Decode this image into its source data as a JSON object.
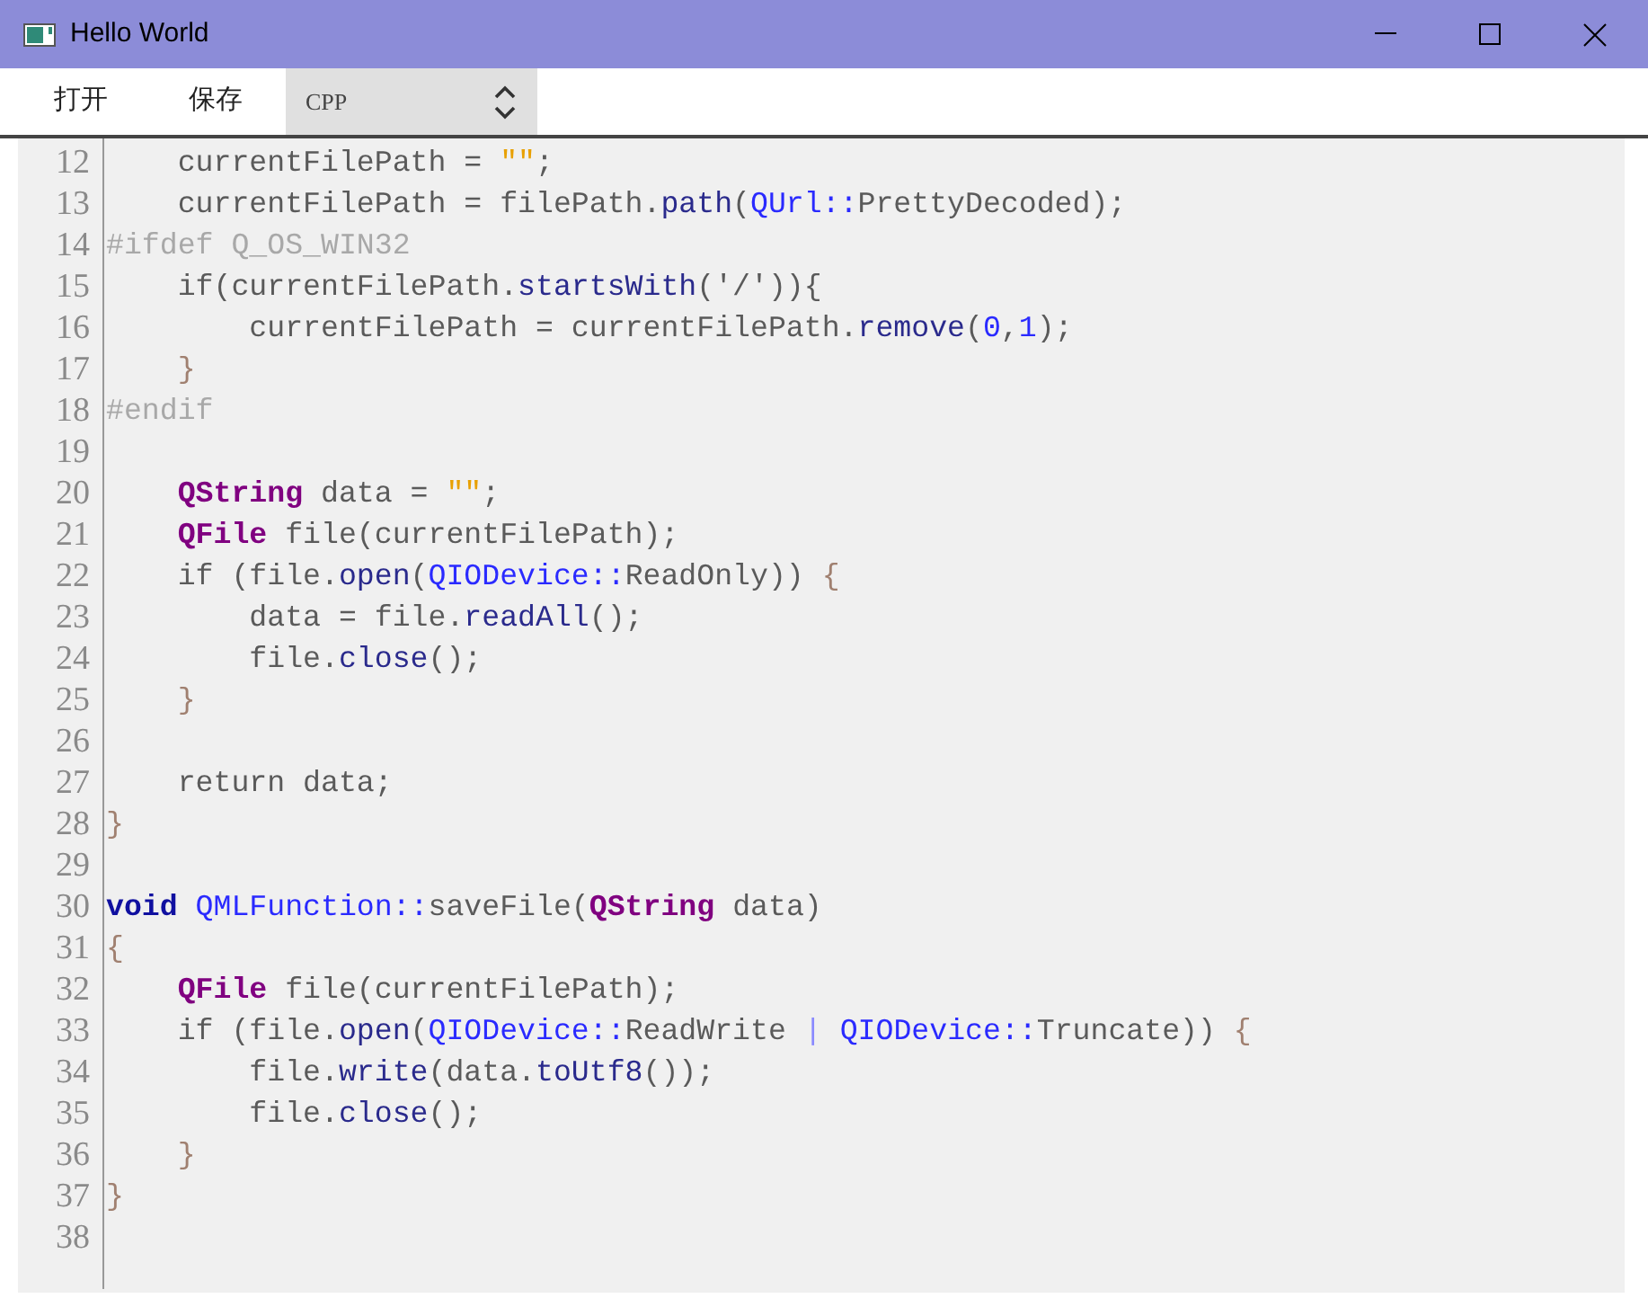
{
  "window": {
    "title": "Hello World"
  },
  "toolbar": {
    "buttons": [
      {
        "label": "打开"
      },
      {
        "label": "保存"
      }
    ],
    "language_select": {
      "value": "CPP"
    }
  },
  "editor": {
    "lines": [
      {
        "number": "12",
        "tokens": [
          {
            "kind": "plain",
            "text": "    currentFilePath = "
          },
          {
            "kind": "string",
            "text": "\"\""
          },
          {
            "kind": "plain",
            "text": ";"
          }
        ]
      },
      {
        "number": "13",
        "tokens": [
          {
            "kind": "plain",
            "text": "    currentFilePath = filePath."
          },
          {
            "kind": "method",
            "text": "path"
          },
          {
            "kind": "plain",
            "text": "("
          },
          {
            "kind": "scope",
            "text": "QUrl::"
          },
          {
            "kind": "plain",
            "text": "PrettyDecoded);"
          }
        ]
      },
      {
        "number": "14",
        "tokens": [
          {
            "kind": "preproc",
            "text": "#ifdef Q_OS_WIN32"
          }
        ]
      },
      {
        "number": "15",
        "tokens": [
          {
            "kind": "plain",
            "text": "    if(currentFilePath."
          },
          {
            "kind": "method",
            "text": "startsWith"
          },
          {
            "kind": "plain",
            "text": "('/')){"
          }
        ]
      },
      {
        "number": "16",
        "tokens": [
          {
            "kind": "plain",
            "text": "        currentFilePath = currentFilePath."
          },
          {
            "kind": "method",
            "text": "remove"
          },
          {
            "kind": "plain",
            "text": "("
          },
          {
            "kind": "number",
            "text": "0"
          },
          {
            "kind": "plain",
            "text": ","
          },
          {
            "kind": "number",
            "text": "1"
          },
          {
            "kind": "plain",
            "text": ");"
          }
        ]
      },
      {
        "number": "17",
        "tokens": [
          {
            "kind": "brace",
            "text": "    }"
          }
        ]
      },
      {
        "number": "18",
        "tokens": [
          {
            "kind": "preproc",
            "text": "#endif"
          }
        ]
      },
      {
        "number": "19"
      },
      {
        "number": "20",
        "tokens": [
          {
            "kind": "type",
            "text": "    QString"
          },
          {
            "kind": "plain",
            "text": " data = "
          },
          {
            "kind": "string",
            "text": "\"\""
          },
          {
            "kind": "plain",
            "text": ";"
          }
        ]
      },
      {
        "number": "21",
        "tokens": [
          {
            "kind": "type",
            "text": "    QFile"
          },
          {
            "kind": "plain",
            "text": " file(currentFilePath);"
          }
        ]
      },
      {
        "number": "22",
        "tokens": [
          {
            "kind": "plain",
            "text": "    if (file."
          },
          {
            "kind": "method",
            "text": "open"
          },
          {
            "kind": "plain",
            "text": "("
          },
          {
            "kind": "scope",
            "text": "QIODevice::"
          },
          {
            "kind": "plain",
            "text": "ReadOnly)) "
          },
          {
            "kind": "brace",
            "text": "{"
          }
        ]
      },
      {
        "number": "23",
        "tokens": [
          {
            "kind": "plain",
            "text": "        data = file."
          },
          {
            "kind": "method",
            "text": "readAll"
          },
          {
            "kind": "plain",
            "text": "();"
          }
        ]
      },
      {
        "number": "24",
        "tokens": [
          {
            "kind": "plain",
            "text": "        file."
          },
          {
            "kind": "method",
            "text": "close"
          },
          {
            "kind": "plain",
            "text": "();"
          }
        ]
      },
      {
        "number": "25",
        "tokens": [
          {
            "kind": "brace",
            "text": "    }"
          }
        ]
      },
      {
        "number": "26"
      },
      {
        "number": "27",
        "tokens": [
          {
            "kind": "plain",
            "text": "    return data;"
          }
        ]
      },
      {
        "number": "28",
        "tokens": [
          {
            "kind": "brace",
            "text": "}"
          }
        ]
      },
      {
        "number": "29"
      },
      {
        "number": "30",
        "tokens": [
          {
            "kind": "keyword",
            "text": "void"
          },
          {
            "kind": "scope",
            "text": " QMLFunction::"
          },
          {
            "kind": "plain",
            "text": "saveFile("
          },
          {
            "kind": "type",
            "text": "QString"
          },
          {
            "kind": "plain",
            "text": " data)"
          }
        ]
      },
      {
        "number": "31",
        "tokens": [
          {
            "kind": "brace",
            "text": "{"
          }
        ]
      },
      {
        "number": "32",
        "tokens": [
          {
            "kind": "type",
            "text": "    QFile"
          },
          {
            "kind": "plain",
            "text": " file(currentFilePath);"
          }
        ]
      },
      {
        "number": "33",
        "tokens": [
          {
            "kind": "plain",
            "text": "    if (file."
          },
          {
            "kind": "method",
            "text": "open"
          },
          {
            "kind": "plain",
            "text": "("
          },
          {
            "kind": "scope",
            "text": "QIODevice::"
          },
          {
            "kind": "plain",
            "text": "ReadWrite "
          },
          {
            "kind": "operator",
            "text": "| "
          },
          {
            "kind": "scope",
            "text": "QIODevice::"
          },
          {
            "kind": "plain",
            "text": "Truncate)) "
          },
          {
            "kind": "brace",
            "text": "{"
          }
        ]
      },
      {
        "number": "34",
        "tokens": [
          {
            "kind": "plain",
            "text": "        file."
          },
          {
            "kind": "method",
            "text": "write"
          },
          {
            "kind": "plain",
            "text": "(data."
          },
          {
            "kind": "method",
            "text": "toUtf8"
          },
          {
            "kind": "plain",
            "text": "());"
          }
        ]
      },
      {
        "number": "35",
        "tokens": [
          {
            "kind": "plain",
            "text": "        file."
          },
          {
            "kind": "method",
            "text": "close"
          },
          {
            "kind": "plain",
            "text": "();"
          }
        ]
      },
      {
        "number": "36",
        "tokens": [
          {
            "kind": "brace",
            "text": "    }"
          }
        ]
      },
      {
        "number": "37",
        "tokens": [
          {
            "kind": "brace",
            "text": "}"
          }
        ]
      },
      {
        "number": "38"
      }
    ]
  }
}
